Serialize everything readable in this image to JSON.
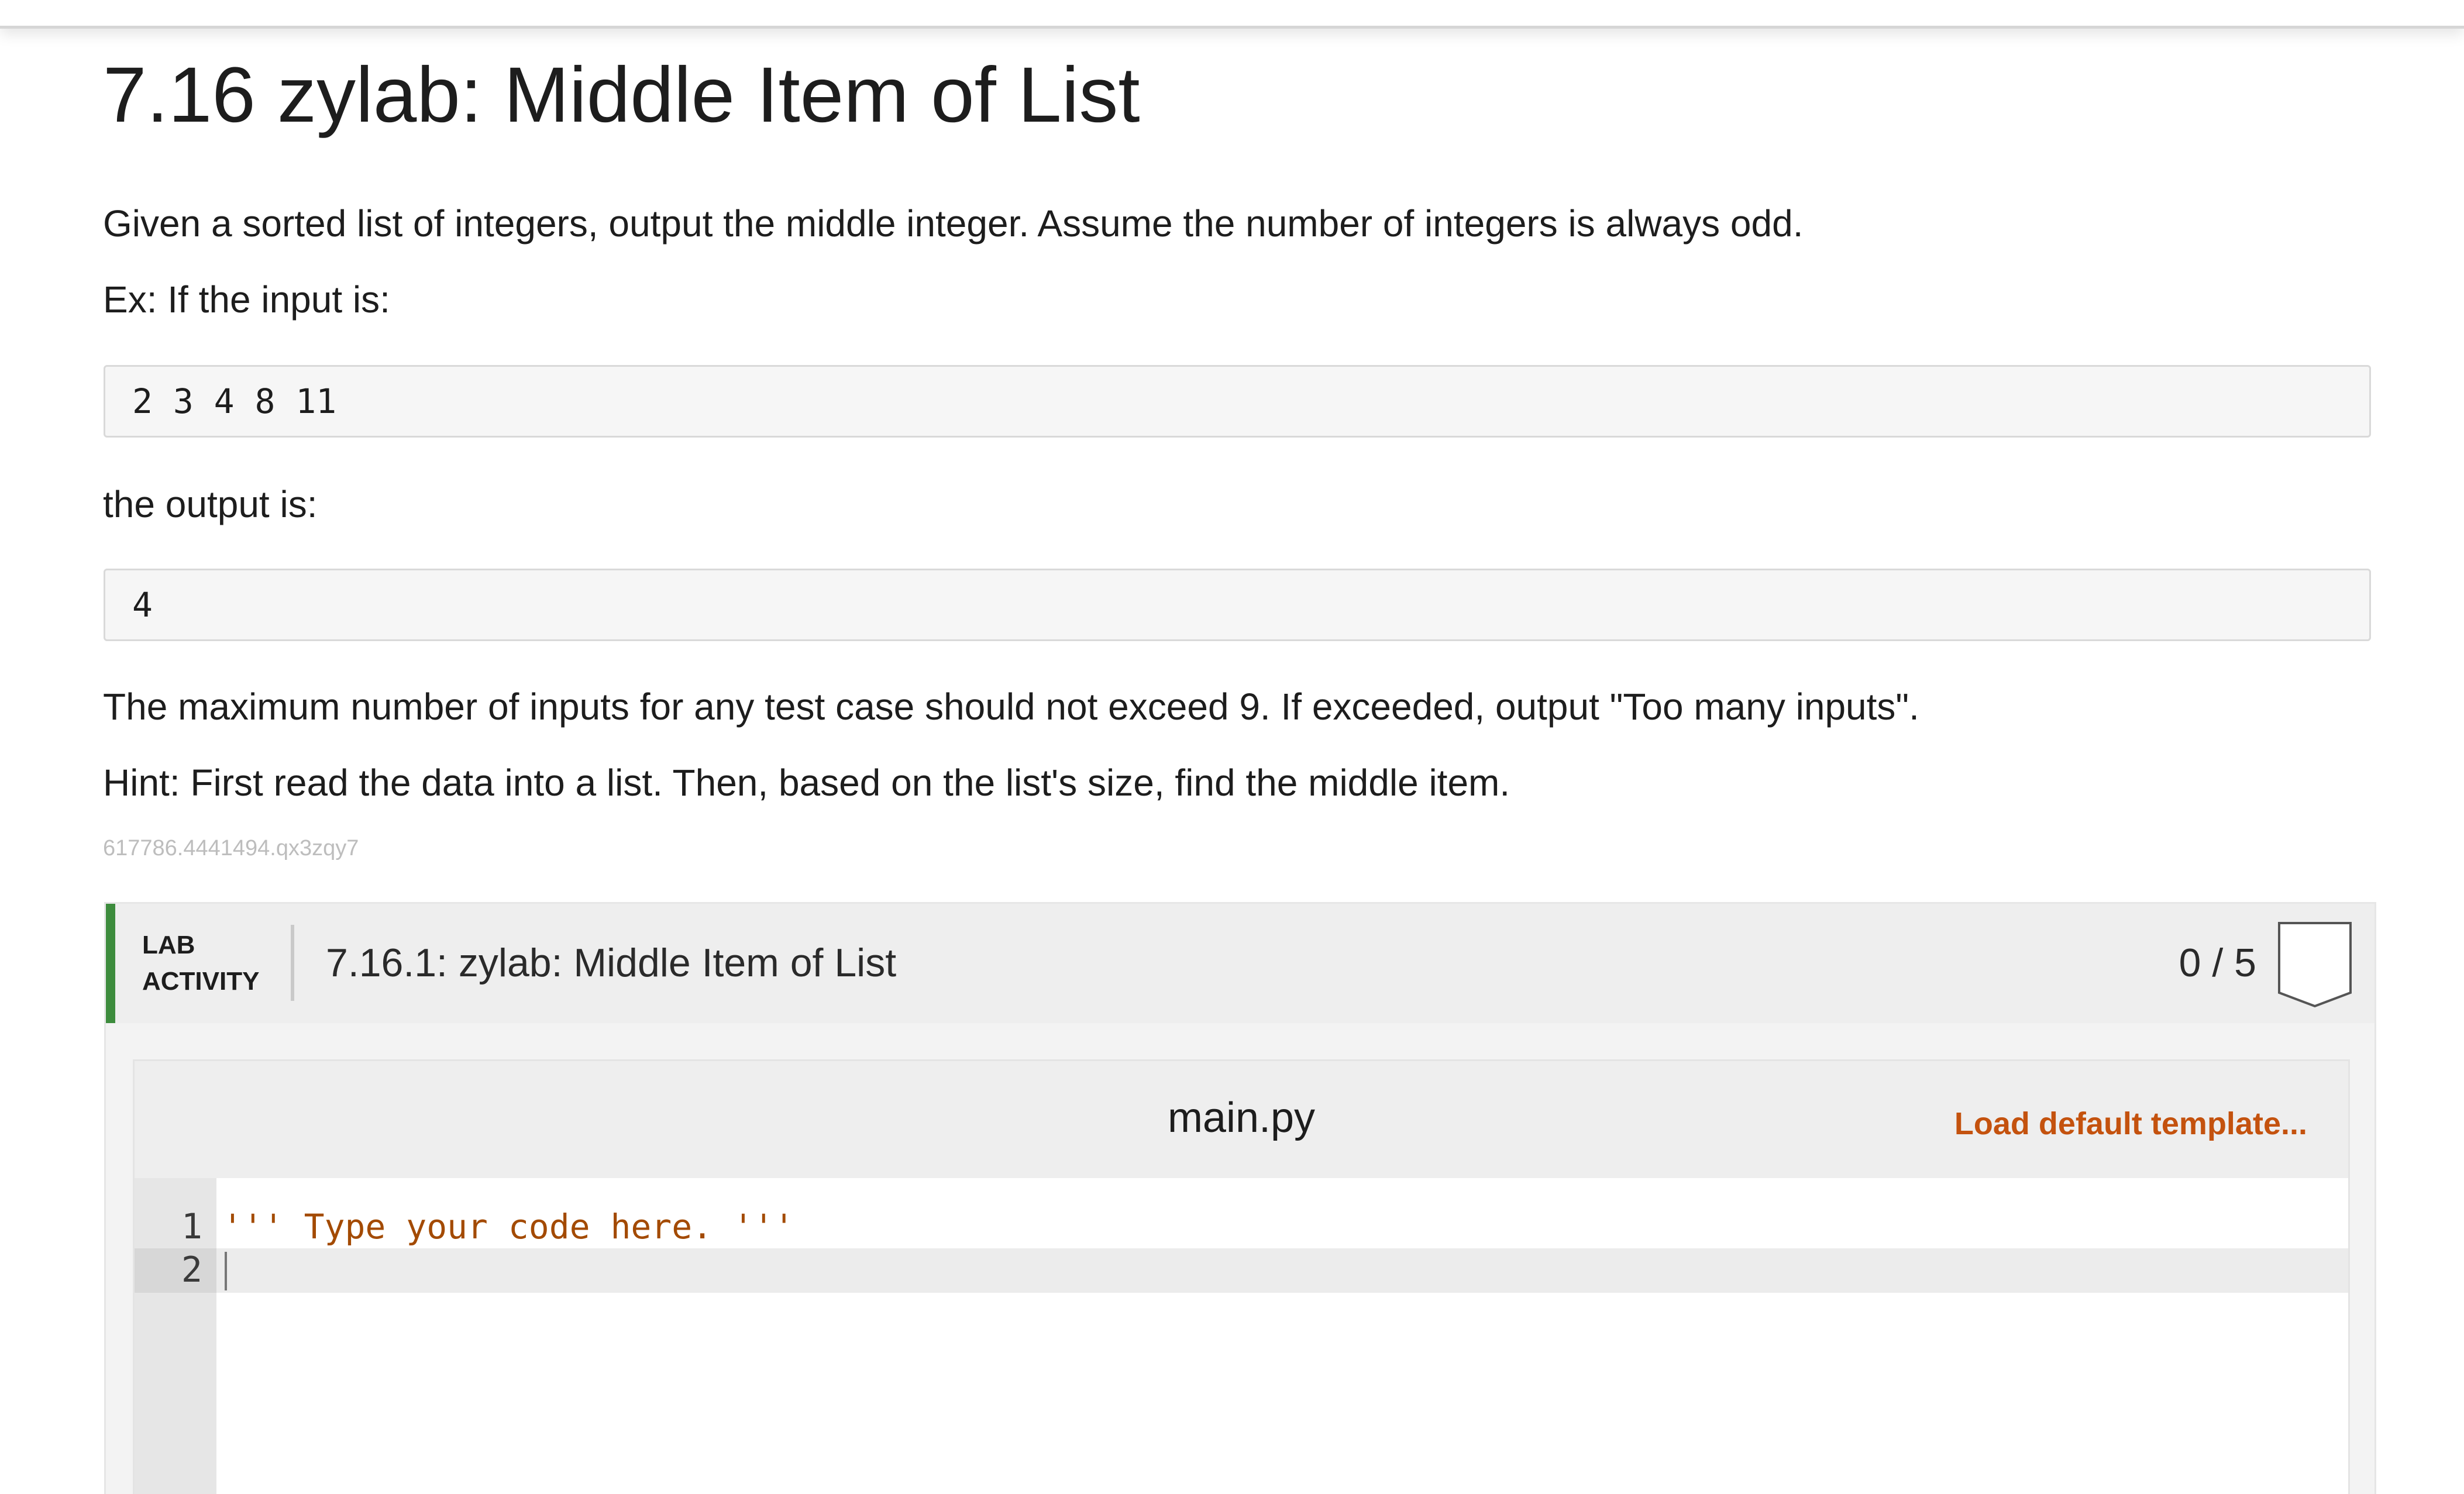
{
  "problem": {
    "title": "7.16 zylab: Middle Item of List",
    "paragraphs": {
      "intro": "Given a sorted list of integers, output the middle integer. Assume the number of integers is always odd.",
      "example_input_label": "Ex: If the input is:",
      "example_input": "2 3 4 8 11",
      "example_output_label": "the output is:",
      "example_output": "4",
      "limit_note": "The maximum number of inputs for any test case should not exceed 9. If exceeded, output \"Too many inputs\".",
      "hint": "Hint: First read the data into a list. Then, based on the list's size, find the middle item."
    },
    "id_code": "617786.4441494.qx3zqy7"
  },
  "lab": {
    "tag_line1": "LAB",
    "tag_line2": "ACTIVITY",
    "title": "7.16.1: zylab: Middle Item of List",
    "score": "0 / 5",
    "accent_color": "#3d8c3d",
    "badge_icon": "shield-outline-icon"
  },
  "editor": {
    "file_name": "main.py",
    "load_template_label": "Load default template...",
    "load_template_color": "#c4520e",
    "lines": [
      {
        "number": "1",
        "code": "''' Type your code here. '''"
      },
      {
        "number": "2",
        "code": ""
      }
    ],
    "active_line": "2"
  }
}
